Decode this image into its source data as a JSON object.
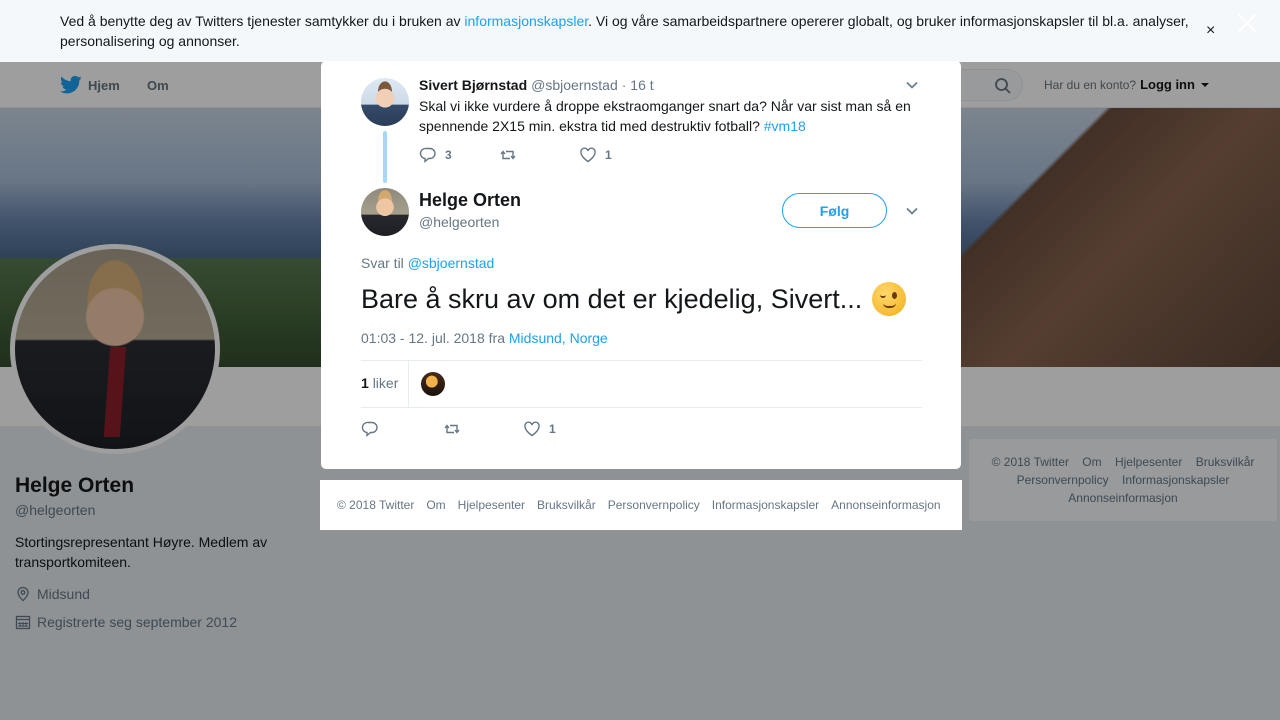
{
  "cookie": {
    "text_before": "Ved å benytte deg av Twitters tjenester samtykker du i bruken av ",
    "link": "informasjonskapsler",
    "text_after": ". Vi og våre samarbeidspartnere opererer globalt, og bruker informasjonskapsler til bl.a. analyser, personalisering og annonser.",
    "close": "×"
  },
  "nav": {
    "home": "Hjem",
    "about": "Om",
    "login_prompt": "Har du en konto?",
    "login": "Logg inn"
  },
  "profile": {
    "name": "Helge Orten",
    "handle": "@helgeorten",
    "bio": "Stortingsrepresentant Høyre. Medlem av transportkomiteen.",
    "location": "Midsund",
    "joined": "Registrerte seg september 2012"
  },
  "right_footer": {
    "items": [
      "© 2018 Twitter",
      "Om",
      "Hjelpesenter",
      "Bruksvilkår",
      "Personvernpolicy",
      "Informasjonskapsler",
      "Annonseinformasjon"
    ]
  },
  "parent_tweet": {
    "name": "Sivert Bjørnstad",
    "handle": "@sbjoernstad",
    "time": "· 16 t",
    "text": "Skal vi ikke vurdere å droppe ekstraomganger snart da? Når var sist man så en spennende 2X15 min. ekstra tid med destruktiv fotball?",
    "hashtag": "#vm18",
    "replies": "3",
    "likes": "1"
  },
  "main_tweet": {
    "name": "Helge Orten",
    "handle": "@helgeorten",
    "follow": "Følg",
    "reply_prefix": "Svar til",
    "reply_to": "@sbjoernstad",
    "text": "Bare å skru av om det er kjedelig, Sivert...",
    "emoji": "winking-face",
    "timestamp": "01:03 - 12. jul. 2018 fra",
    "place": "Midsund, Norge",
    "like_count": "1",
    "like_label": "liker",
    "action_likes": "1"
  },
  "modal_footer": {
    "items": [
      "© 2018 Twitter",
      "Om",
      "Hjelpesenter",
      "Bruksvilkår",
      "Personvernpolicy",
      "Informasjonskapsler",
      "Annonseinformasjon"
    ]
  },
  "colors": {
    "brand": "#1da1f2",
    "text": "#14171a",
    "muted": "#657786",
    "thread": "#a5d7f7"
  }
}
